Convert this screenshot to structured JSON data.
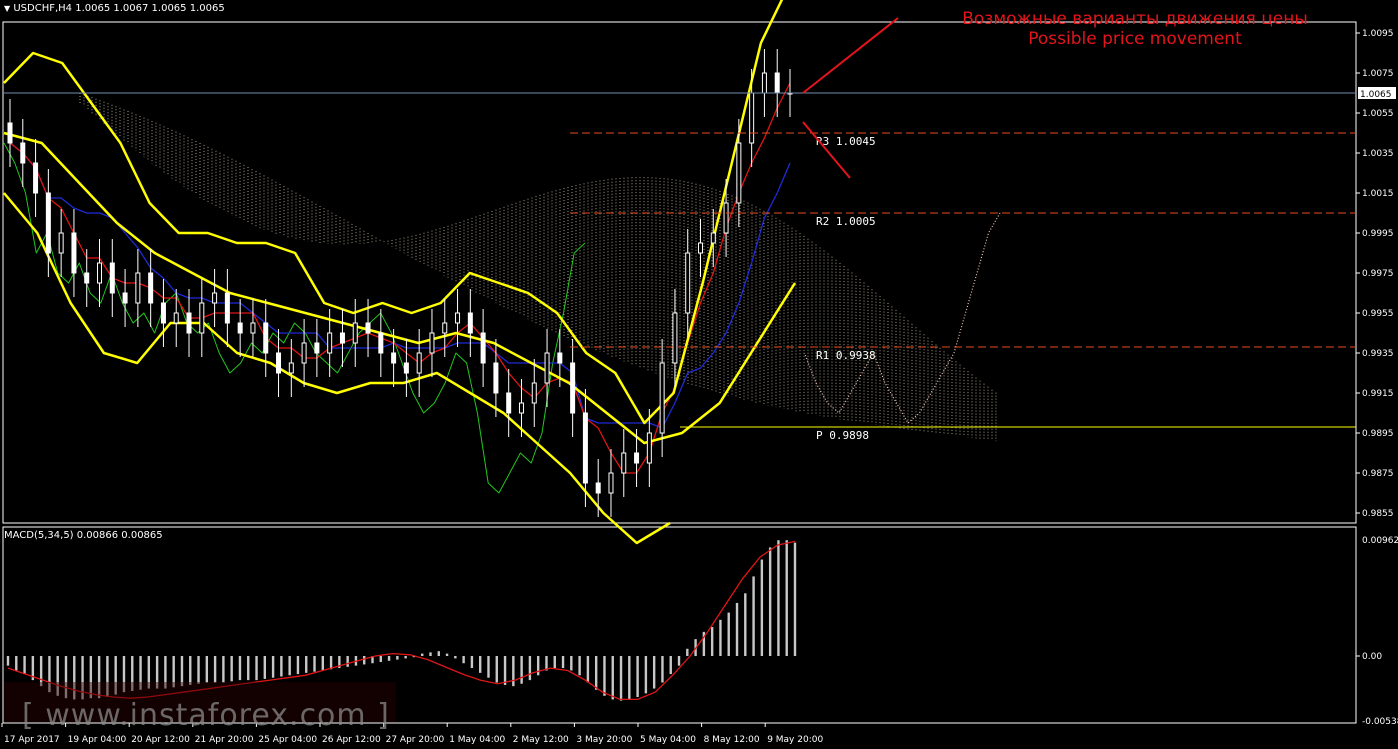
{
  "header": {
    "main_info": "USDCHF,H4  1.0065 1.0067 1.0065 1.0065",
    "macd_info": "MACD(5,34,5) 0.00866 0.00865"
  },
  "annotation": {
    "line1": "Возможные варианты движения цены",
    "line2": "Possible price movement"
  },
  "watermark": "[ www.instaforex.com ]",
  "colors": {
    "background": "#000000",
    "frame": "#ffffff",
    "candle": "#ffffff",
    "bollinger": "#ffff00",
    "chikou": "#22c71e",
    "kijun": "#1f2bd6",
    "tenkan": "#e01515",
    "cloud": "#f2e6c8",
    "pivot": "#ffff00",
    "resistance": "#e24b1c",
    "annotation": "#e4141b",
    "macd_hist": "#c8c8c8",
    "macd_signal": "#e01515"
  },
  "chart_data": [
    {
      "type": "candlestick",
      "title": "USDCHF,H4",
      "symbol": "USDCHF",
      "timeframe": "H4",
      "ohlc_header": {
        "open": 1.0065,
        "high": 1.0067,
        "low": 1.0065,
        "close": 1.0065
      },
      "current_price_label": "1.0065",
      "ylim": [
        1.085,
        1.0105
      ],
      "yticks": [
        "1.0095",
        "1.0075",
        "1.0055",
        "1.0035",
        "1.0015",
        "0.9995",
        "0.9975",
        "0.9955",
        "0.9935",
        "0.9915",
        "0.9895",
        "0.9875",
        "0.9855"
      ],
      "xticks": [
        "17 Apr 2017",
        "19 Apr 04:00",
        "20 Apr 12:00",
        "21 Apr 20:00",
        "25 Apr 04:00",
        "26 Apr 12:00",
        "27 Apr 20:00",
        "1 May 04:00",
        "2 May 12:00",
        "3 May 20:00",
        "5 May 04:00",
        "8 May 12:00",
        "9 May 20:00"
      ],
      "levels": [
        {
          "name": "R3",
          "label": "R3  1.0045",
          "value": 1.0045
        },
        {
          "name": "R2",
          "label": "R2  1.0005",
          "value": 1.0005
        },
        {
          "name": "R1",
          "label": "R1  0.9938",
          "value": 0.9938
        },
        {
          "name": "P",
          "label": "P  0.9898",
          "value": 0.9898
        }
      ],
      "close_series": [
        1.004,
        1.003,
        1.0015,
        0.9985,
        0.9995,
        0.9975,
        0.997,
        0.998,
        0.9965,
        0.996,
        0.9975,
        0.996,
        0.995,
        0.9955,
        0.9945,
        0.996,
        0.9965,
        0.995,
        0.9945,
        0.995,
        0.9935,
        0.9925,
        0.993,
        0.994,
        0.9935,
        0.9945,
        0.994,
        0.995,
        0.9945,
        0.9935,
        0.993,
        0.9925,
        0.9935,
        0.9945,
        0.995,
        0.9955,
        0.9945,
        0.993,
        0.9915,
        0.9905,
        0.991,
        0.992,
        0.9935,
        0.993,
        0.9905,
        0.987,
        0.9865,
        0.9875,
        0.9885,
        0.988,
        0.9895,
        0.993,
        0.9955,
        0.9985,
        0.999,
        0.9995,
        1.001,
        1.004,
        1.0065,
        1.0075,
        1.0065,
        1.0065
      ],
      "bollinger_upper": [
        1.007,
        1.0085,
        1.008,
        1.006,
        1.004,
        1.001,
        0.9995,
        0.9995,
        0.999,
        0.999,
        0.9985,
        0.996,
        0.9955,
        0.996,
        0.9955,
        0.996,
        0.9975,
        0.997,
        0.9965,
        0.9955,
        0.9935,
        0.9925,
        0.99,
        0.9915,
        0.997,
        1.003,
        1.009,
        1.012
      ],
      "bollinger_middle": [
        1.0045,
        1.004,
        1.002,
        1.0,
        0.9985,
        0.9975,
        0.9965,
        0.996,
        0.9955,
        0.995,
        0.9945,
        0.994,
        0.9945,
        0.994,
        0.993,
        0.992,
        0.9905,
        0.989,
        0.9895,
        0.991,
        0.994,
        0.997
      ],
      "bollinger_lower": [
        1.0015,
        0.9995,
        0.996,
        0.9935,
        0.993,
        0.995,
        0.995,
        0.9935,
        0.993,
        0.992,
        0.9915,
        0.992,
        0.992,
        0.9925,
        0.9915,
        0.9905,
        0.989,
        0.9875,
        0.9855,
        0.984,
        0.985
      ]
    },
    {
      "type": "bar",
      "title": "MACD(5,34,5)",
      "main_value": 0.00866,
      "signal_value": 0.00865,
      "ylim": [
        -0.00538,
        0.00962
      ],
      "yticks": [
        "0.00962",
        "0.00",
        "-0.00538"
      ],
      "values": [
        -0.0008,
        -0.0012,
        -0.0015,
        -0.002,
        -0.0025,
        -0.003,
        -0.0033,
        -0.0035,
        -0.0036,
        -0.0036,
        -0.0035,
        -0.0035,
        -0.0034,
        -0.0032,
        -0.003,
        -0.0029,
        -0.0028,
        -0.0027,
        -0.0027,
        -0.0027,
        -0.0026,
        -0.0025,
        -0.0024,
        -0.0023,
        -0.0022,
        -0.0022,
        -0.0022,
        -0.0021,
        -0.002,
        -0.002,
        -0.002,
        -0.0019,
        -0.0018,
        -0.0017,
        -0.0016,
        -0.0015,
        -0.0014,
        -0.0013,
        -0.0012,
        -0.0011,
        -0.001,
        -0.0009,
        -0.0008,
        -0.0007,
        -0.0006,
        -0.0005,
        -0.0004,
        -0.0003,
        -0.0002,
        -0.0001,
        0.0002,
        0.0003,
        0.0004,
        0.0002,
        -0.0002,
        -0.0006,
        -0.001,
        -0.0014,
        -0.0018,
        -0.0022,
        -0.0024,
        -0.0025,
        -0.0023,
        -0.002,
        -0.0016,
        -0.0012,
        -0.001,
        -0.001,
        -0.0012,
        -0.0016,
        -0.0022,
        -0.0028,
        -0.0033,
        -0.0036,
        -0.0037,
        -0.0036,
        -0.0034,
        -0.0031,
        -0.0027,
        -0.0022,
        -0.0015,
        -0.0008,
        0.0006,
        0.0014,
        0.002,
        0.0024,
        0.003,
        0.0036,
        0.0044,
        0.0052,
        0.0066,
        0.008,
        0.009,
        0.0096,
        0.0096,
        0.0094
      ],
      "signal": [
        -0.001,
        -0.0015,
        -0.002,
        -0.0025,
        -0.0029,
        -0.0032,
        -0.0034,
        -0.0035,
        -0.0034,
        -0.0032,
        -0.003,
        -0.0028,
        -0.0026,
        -0.0024,
        -0.0022,
        -0.002,
        -0.0018,
        -0.0016,
        -0.0012,
        -0.0008,
        -0.0004,
        0.0,
        0.0002,
        0.0001,
        -0.0003,
        -0.0009,
        -0.0015,
        -0.002,
        -0.0023,
        -0.002,
        -0.0014,
        -0.001,
        -0.0012,
        -0.002,
        -0.003,
        -0.0036,
        -0.0036,
        -0.003,
        -0.0016,
        0.0,
        0.002,
        0.0042,
        0.0064,
        0.0082,
        0.0092,
        0.0095
      ]
    }
  ]
}
